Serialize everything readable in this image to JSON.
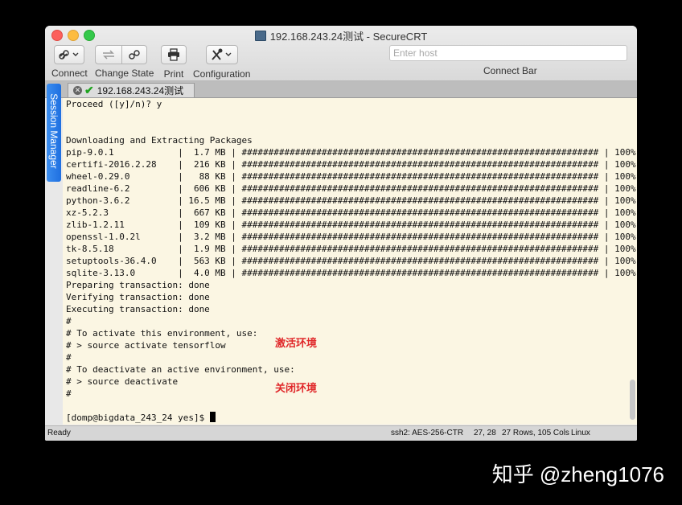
{
  "window": {
    "title": "192.168.243.24测试 - SecureCRT"
  },
  "toolbar": {
    "connect_label": "Connect",
    "change_state_label": "Change State",
    "print_label": "Print",
    "configuration_label": "Configuration",
    "host_placeholder": "Enter host",
    "connect_bar_label": "Connect Bar"
  },
  "tab": {
    "label": "192.168.243.24测试"
  },
  "session_manager": {
    "label": "Session Manager"
  },
  "terminal": {
    "text": "Proceed ([y]/n)? y\n\n\nDownloading and Extracting Packages\npip-9.0.1            |  1.7 MB | ################################################################### | 100%\ncertifi-2016.2.28    |  216 KB | ################################################################### | 100%\nwheel-0.29.0         |   88 KB | ################################################################### | 100%\nreadline-6.2         |  606 KB | ################################################################### | 100%\npython-3.6.2         | 16.5 MB | ################################################################### | 100%\nxz-5.2.3             |  667 KB | ################################################################### | 100%\nzlib-1.2.11          |  109 KB | ################################################################### | 100%\nopenssl-1.0.2l       |  3.2 MB | ################################################################### | 100%\ntk-8.5.18            |  1.9 MB | ################################################################### | 100%\nsetuptools-36.4.0    |  563 KB | ################################################################### | 100%\nsqlite-3.13.0        |  4.0 MB | ################################################################### | 100%\nPreparing transaction: done\nVerifying transaction: done\nExecuting transaction: done\n#\n# To activate this environment, use:\n# > source activate tensorflow\n#\n# To deactivate an active environment, use:\n# > source deactivate\n#\n\n[domp@bigdata_243_24 yes]$ "
  },
  "annotations": {
    "activate": "激活环境",
    "deactivate": "关闭环境"
  },
  "statusbar": {
    "state": "Ready",
    "cipher": "ssh2: AES-256-CTR",
    "cursor_pos": "27, 28",
    "dims": "27 Rows, 105 Cols",
    "os": "Linux"
  },
  "watermark": "知乎 @zheng1076",
  "colors": {
    "terminal_bg": "#fbf6e3",
    "annotation": "#e0282a",
    "session_manager": "#1f6fe0"
  }
}
